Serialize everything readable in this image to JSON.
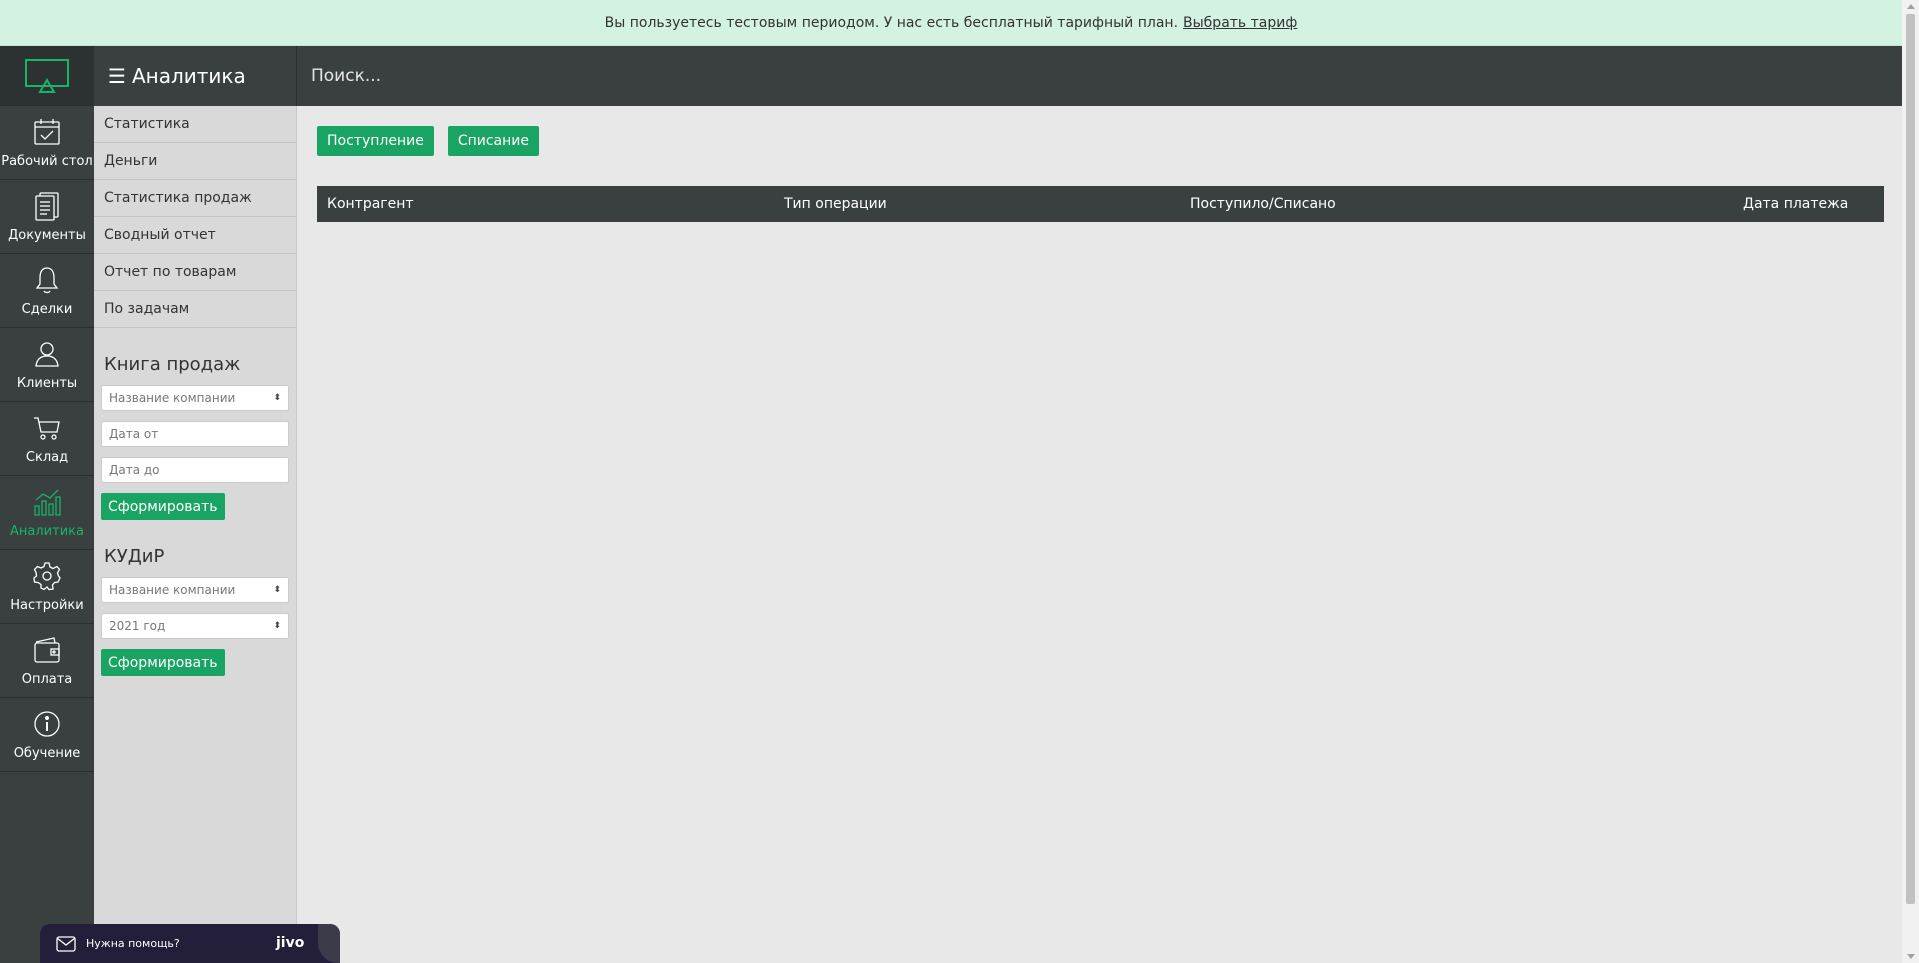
{
  "banner": {
    "text": "Вы пользуетесь тестовым периодом. У нас есть бесплатный тарифный план.",
    "link": "Выбрать тариф"
  },
  "rail": {
    "items": [
      {
        "label": "Рабочий стол",
        "icon": "calendar-check-icon"
      },
      {
        "label": "Документы",
        "icon": "document-icon"
      },
      {
        "label": "Сделки",
        "icon": "bell-icon"
      },
      {
        "label": "Клиенты",
        "icon": "users-icon"
      },
      {
        "label": "Склад",
        "icon": "cart-icon"
      },
      {
        "label": "Аналитика",
        "icon": "chart-icon"
      },
      {
        "label": "Настройки",
        "icon": "gear-icon"
      },
      {
        "label": "Оплата",
        "icon": "wallet-icon"
      },
      {
        "label": "Обучение",
        "icon": "info-icon"
      }
    ],
    "active_color": "#19b36a"
  },
  "header": {
    "section_title": "Аналитика",
    "search_placeholder": "Поиск..."
  },
  "submenu": {
    "items": [
      "Статистика",
      "Деньги",
      "Статистика продаж",
      "Сводный отчет",
      "Отчет по товарам",
      "По задачам"
    ]
  },
  "sales_book": {
    "title": "Книга продаж",
    "company_select": "Название компании",
    "date_from_placeholder": "Дата от",
    "date_to_placeholder": "Дата до",
    "submit": "Сформировать"
  },
  "kudir": {
    "title": "КУДиР",
    "company_select": "Название компании",
    "year_select": "2021 год",
    "submit": "Сформировать"
  },
  "main": {
    "btn_income": "Поступление",
    "btn_writeoff": "Списание",
    "columns": [
      "Контрагент",
      "Тип операции",
      "Поступило/Списано",
      "Дата платежа"
    ]
  },
  "help_widget": {
    "text": "Нужна помощь?",
    "brand": "jivo"
  },
  "colors": {
    "accent_green": "#19a463",
    "dark_bar": "#3a4040",
    "banner_bg": "#d4f2e2"
  }
}
